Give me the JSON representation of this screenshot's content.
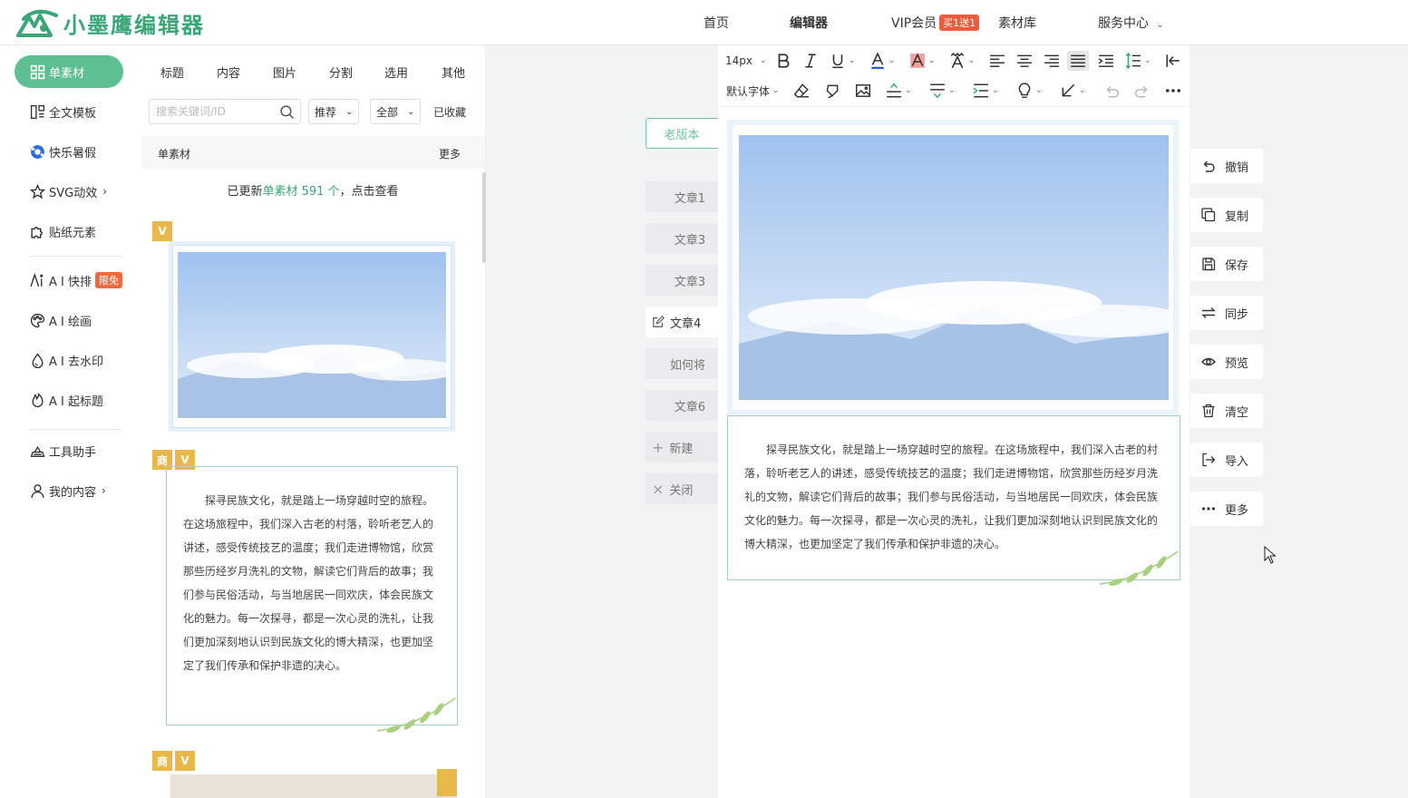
{
  "app": {
    "name": "小墨鹰编辑器",
    "brand_color": "#3aa576"
  },
  "topnav": {
    "home": "首页",
    "editor": "编辑器",
    "vip": "VIP会员",
    "vip_badge": "买1送1",
    "library": "素材库",
    "service": "服务中心"
  },
  "leftnav": {
    "items": [
      {
        "label": "单素材",
        "icon": "grid-icon"
      },
      {
        "label": "全文模板",
        "icon": "template-icon"
      },
      {
        "label": "快乐暑假",
        "icon": "ball-icon"
      },
      {
        "label": "SVG动效",
        "icon": "star-icon"
      },
      {
        "label": "贴纸元素",
        "icon": "puzzle-icon"
      },
      {
        "label": "A I 快排",
        "icon": "ai-icon",
        "badge": "限免"
      },
      {
        "label": "A I 绘画",
        "icon": "palette-icon"
      },
      {
        "label": "A I 去水印",
        "icon": "drop-icon"
      },
      {
        "label": "A I 起标题",
        "icon": "flame-icon"
      },
      {
        "label": "工具助手",
        "icon": "tool-icon"
      },
      {
        "label": "我的内容",
        "icon": "user-icon"
      }
    ]
  },
  "material": {
    "tabs": [
      "标题",
      "内容",
      "图片",
      "分割",
      "选用",
      "其他"
    ],
    "search_placeholder": "搜索关键词/ID",
    "filter_sort": "推荐",
    "filter_range": "全部",
    "favorites": "已收藏",
    "section_title": "单素材",
    "section_more": "更多",
    "update_prefix": "已更新",
    "update_highlight": "单素材 591 个",
    "update_suffix": "，点击查看",
    "badges": {
      "v": "V",
      "shang": "商"
    },
    "card_text": "探寻民族文化，就是踏上一场穿越时空的旅程。在这场旅程中，我们深入古老的村落，聆听老艺人的讲述，感受传统技艺的温度；我们走进博物馆，欣赏那些历经岁月洗礼的文物，解读它们背后的故事；我们参与民俗活动，与当地居民一同欢庆，体会民族文化的魅力。每一次探寻，都是一次心灵的洗礼，让我们更加深刻地认识到民族文化的博大精深，也更加坚定了我们传承和保护非遗的决心。"
  },
  "middle": {
    "old_version": "老版本",
    "tabs": [
      "文章1",
      "文章3",
      "文章3",
      "文章4",
      "如何将",
      "文章6"
    ],
    "new": "新建",
    "close": "关闭"
  },
  "toolbar": {
    "font_size": "14px",
    "font_family": "默认字体"
  },
  "editor": {
    "text": "探寻民族文化，就是踏上一场穿越时空的旅程。在这场旅程中，我们深入古老的村落，聆听老艺人的讲述，感受传统技艺的温度；我们走进博物馆，欣赏那些历经岁月洗礼的文物，解读它们背后的故事；我们参与民俗活动，与当地居民一同欢庆，体会民族文化的魅力。每一次探寻，都是一次心灵的洗礼，让我们更加深刻地认识到民族文化的博大精深，也更加坚定了我们传承和保护非遗的决心。"
  },
  "actions": [
    "撤销",
    "复制",
    "保存",
    "同步",
    "预览",
    "清空",
    "导入",
    "更多"
  ]
}
